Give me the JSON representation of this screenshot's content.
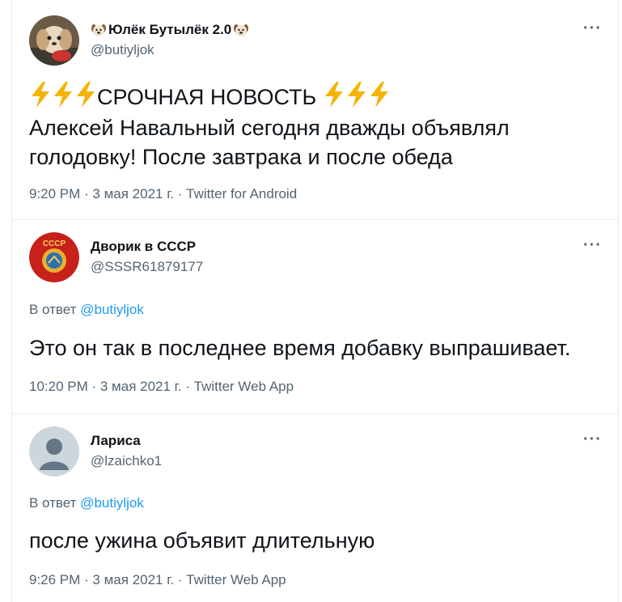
{
  "tweets": [
    {
      "display_name": "Юлёк Бутылёк 2.0",
      "handle": "@butiyljok",
      "text_line1": "СРОЧНАЯ НОВОСТЬ",
      "text_line2": "Алексей Навальный сегодня дважды объявлял",
      "text_line3": "голодовку! После завтрака и после обеда",
      "meta": "9:20 PM · 3 мая 2021 г. · Twitter for Android"
    },
    {
      "display_name": "Дворик в СССР",
      "handle": "@SSSR61879177",
      "reply_prefix": "В ответ",
      "reply_handle": "@butiyljok",
      "text": "Это он так в последнее время добавку выпрашивает.",
      "meta": "10:20 PM · 3 мая 2021 г. · Twitter Web App",
      "avatar_text": "СССР"
    },
    {
      "display_name": "Лариса",
      "handle": "@lzaichko1",
      "reply_prefix": "В ответ",
      "reply_handle": "@butiyljok",
      "text": "после ужина объявит длительную",
      "meta": "9:26 PM · 3 мая 2021 г. · Twitter Web App"
    }
  ],
  "more_icon": "···",
  "colors": {
    "text": "#0f1419",
    "secondary": "#536471",
    "link": "#1d9bf0",
    "divider": "#e6ecf0",
    "bolt": "#f4b400"
  }
}
